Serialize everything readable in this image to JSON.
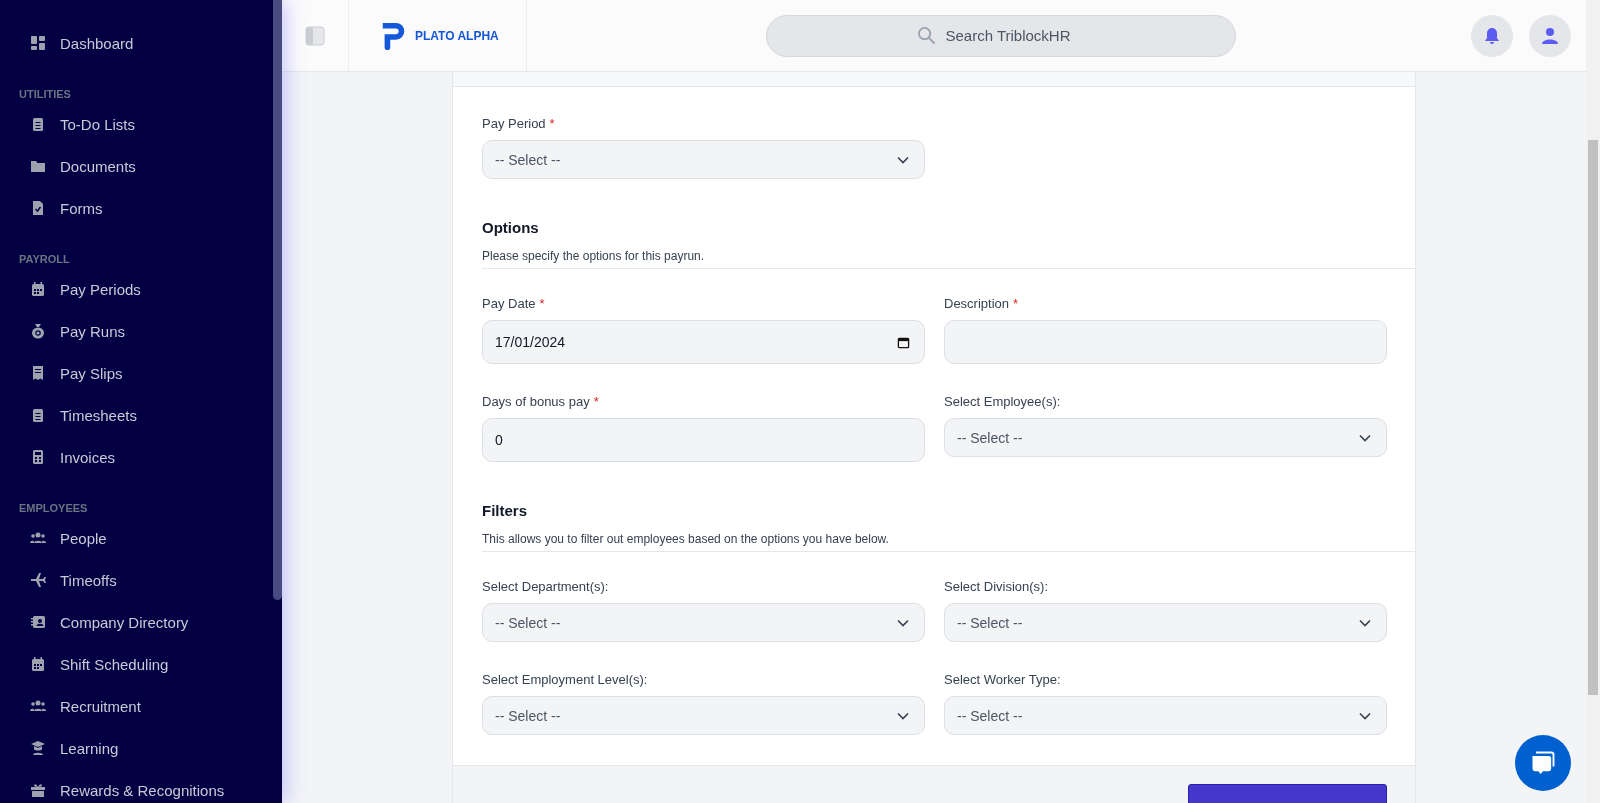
{
  "sidebar": {
    "sections": [
      {
        "items": [
          {
            "label": "Dashboard"
          }
        ]
      },
      {
        "title": "UTILITIES",
        "items": [
          {
            "label": "To-Do Lists"
          },
          {
            "label": "Documents"
          },
          {
            "label": "Forms"
          }
        ]
      },
      {
        "title": "PAYROLL",
        "items": [
          {
            "label": "Pay Periods"
          },
          {
            "label": "Pay Runs"
          },
          {
            "label": "Pay Slips"
          },
          {
            "label": "Timesheets"
          },
          {
            "label": "Invoices"
          }
        ]
      },
      {
        "title": "EMPLOYEES",
        "items": [
          {
            "label": "People"
          },
          {
            "label": "Timeoffs"
          },
          {
            "label": "Company Directory"
          },
          {
            "label": "Shift Scheduling"
          },
          {
            "label": "Recruitment"
          },
          {
            "label": "Learning"
          },
          {
            "label": "Rewards & Recognitions"
          }
        ]
      }
    ]
  },
  "header": {
    "logo": "PLATO ALPHA",
    "search": {
      "placeholder": "Search TriblockHR"
    }
  },
  "form": {
    "sections": [
      {
        "rows": [
          [
            {
              "label": "Pay Period",
              "required_mark": "*",
              "kind": "select",
              "value": "-- Select --"
            }
          ]
        ]
      },
      {
        "heading": "Options",
        "description": "Please specify the options for this payrun.",
        "rows": [
          [
            {
              "label": "Pay Date",
              "required_mark": "*",
              "kind": "date",
              "value": "17/01/2024"
            },
            {
              "label": "Description",
              "required_mark": "*",
              "kind": "text"
            }
          ],
          [
            {
              "label": "Days of bonus pay",
              "required_mark": "*",
              "kind": "text",
              "value": "0"
            },
            {
              "label": "Select Employee(s):",
              "kind": "select",
              "value": "-- Select --"
            }
          ]
        ]
      },
      {
        "heading": "Filters",
        "description": "This allows you to filter out employees based on the options you have below.",
        "rows": [
          [
            {
              "label": "Select Department(s):",
              "kind": "select",
              "value": "-- Select --"
            },
            {
              "label": "Select Division(s):",
              "kind": "select",
              "value": "-- Select --"
            }
          ],
          [
            {
              "label": "Select Employment Level(s):",
              "kind": "select",
              "value": "-- Select --"
            },
            {
              "label": "Select Worker Type:",
              "kind": "select",
              "value": "-- Select --"
            }
          ]
        ]
      }
    ]
  }
}
